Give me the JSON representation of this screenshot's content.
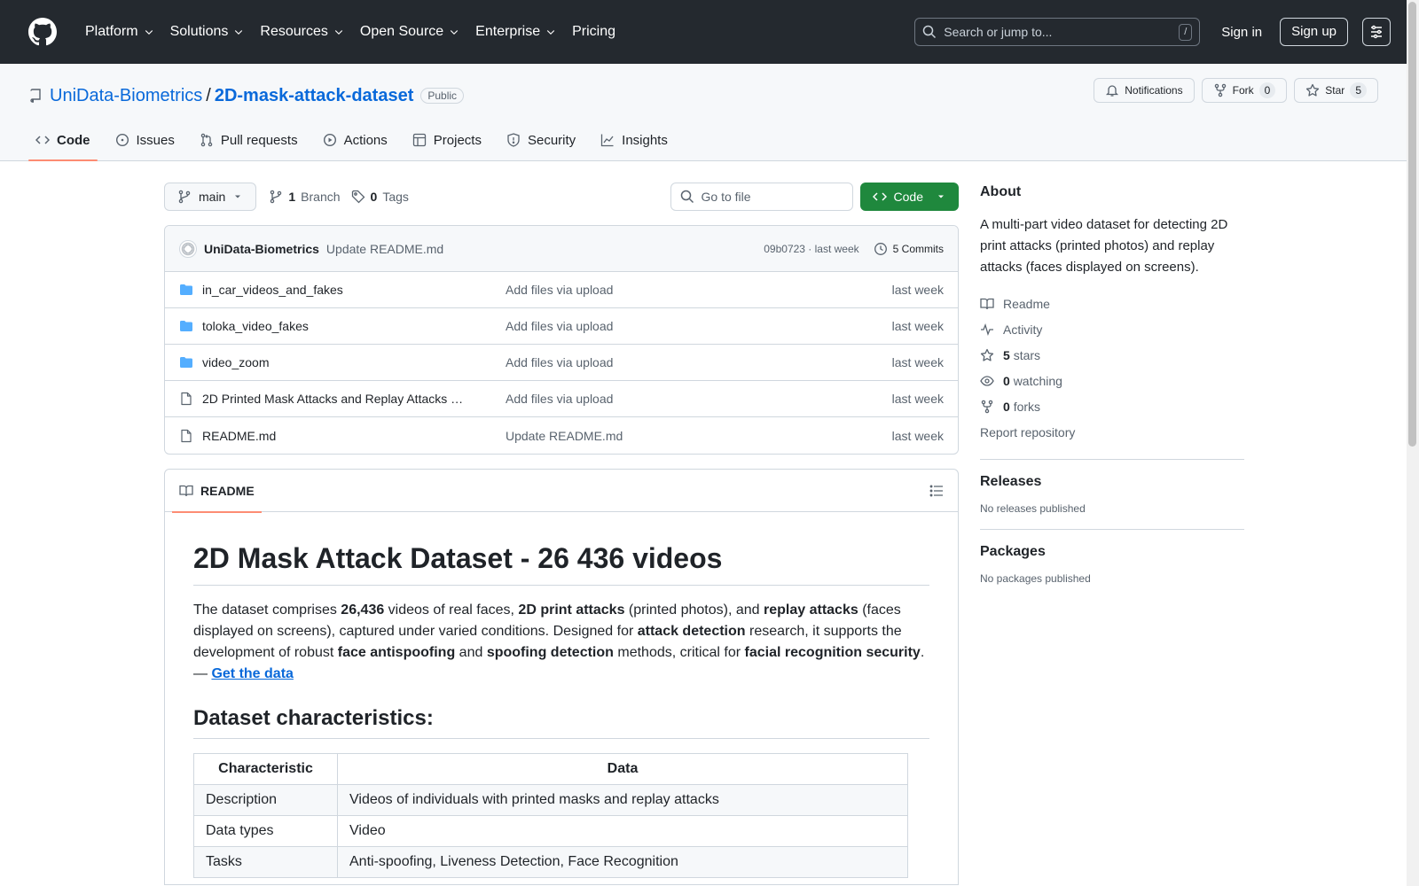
{
  "header": {
    "nav": [
      "Platform",
      "Solutions",
      "Resources",
      "Open Source",
      "Enterprise",
      "Pricing"
    ],
    "search_placeholder": "Search or jump to...",
    "search_key": "/",
    "sign_in": "Sign in",
    "sign_up": "Sign up"
  },
  "repo": {
    "owner": "UniData-Biometrics",
    "separator": "/",
    "name": "2D-mask-attack-dataset",
    "visibility": "Public",
    "notifications": "Notifications",
    "fork_label": "Fork",
    "fork_count": "0",
    "star_label": "Star",
    "star_count": "5"
  },
  "tabs": [
    {
      "label": "Code",
      "icon": "code-icon",
      "active": true
    },
    {
      "label": "Issues",
      "icon": "issue-icon"
    },
    {
      "label": "Pull requests",
      "icon": "pull-request-icon"
    },
    {
      "label": "Actions",
      "icon": "play-icon"
    },
    {
      "label": "Projects",
      "icon": "table-icon"
    },
    {
      "label": "Security",
      "icon": "shield-icon"
    },
    {
      "label": "Insights",
      "icon": "graph-icon"
    }
  ],
  "filebar": {
    "branch": "main",
    "branch_count": "1",
    "branch_label": "Branch",
    "tag_count": "0",
    "tag_label": "Tags",
    "goto_placeholder": "Go to file",
    "code_button": "Code"
  },
  "commit": {
    "author": "UniData-Biometrics",
    "message": "Update README.md",
    "meta": "09b0723 · last week",
    "commits": "5 Commits"
  },
  "files": [
    {
      "type": "folder",
      "name": "in_car_videos_and_fakes",
      "message": "Add files via upload",
      "date": "last week"
    },
    {
      "type": "folder",
      "name": "toloka_video_fakes",
      "message": "Add files via upload",
      "date": "last week"
    },
    {
      "type": "folder",
      "name": "video_zoom",
      "message": "Add files via upload",
      "date": "last week"
    },
    {
      "type": "file",
      "name": "2D Printed Mask Attacks and Replay Attacks …",
      "message": "Add files via upload",
      "date": "last week"
    },
    {
      "type": "file",
      "name": "README.md",
      "message": "Update README.md",
      "date": "last week"
    }
  ],
  "readme": {
    "tab": "README",
    "title": "2D Mask Attack Dataset - 26 436 videos",
    "para": {
      "t1": "The dataset comprises ",
      "b1": "26,436",
      "t2": " videos of real faces, ",
      "b2": "2D print attacks",
      "t3": " (printed photos), and ",
      "b3": "replay attacks",
      "t4": " (faces displayed on screens), captured under varied conditions. Designed for ",
      "b4": "attack detection",
      "t5": " research, it supports the development of robust ",
      "b5": "face antispoofing",
      "t6": " and ",
      "b6": "spoofing detection",
      "t7": " methods, critical for ",
      "b7": "facial recognition security",
      "t8": ". — ",
      "link": "Get the data"
    },
    "h2": "Dataset characteristics:",
    "table": {
      "headers": [
        "Characteristic",
        "Data"
      ],
      "rows": [
        [
          "Description",
          "Videos of individuals with printed masks and replay attacks"
        ],
        [
          "Data types",
          "Video"
        ],
        [
          "Tasks",
          "Anti-spoofing, Liveness Detection, Face Recognition"
        ]
      ]
    }
  },
  "sidebar": {
    "about_title": "About",
    "description": "A multi-part video dataset for detecting 2D print attacks (printed photos) and replay attacks (faces displayed on screens).",
    "readme": "Readme",
    "activity": "Activity",
    "stars_count": "5",
    "stars_label": "stars",
    "watching_count": "0",
    "watching_label": "watching",
    "forks_count": "0",
    "forks_label": "forks",
    "report": "Report repository",
    "releases_title": "Releases",
    "releases_sub": "No releases published",
    "packages_title": "Packages",
    "packages_sub": "No packages published"
  },
  "colors": {
    "header_bg": "#24292f",
    "link": "#0969da",
    "code_button": "#1f883d",
    "tab_underline": "#fd8c73",
    "folder": "#54aeff"
  }
}
